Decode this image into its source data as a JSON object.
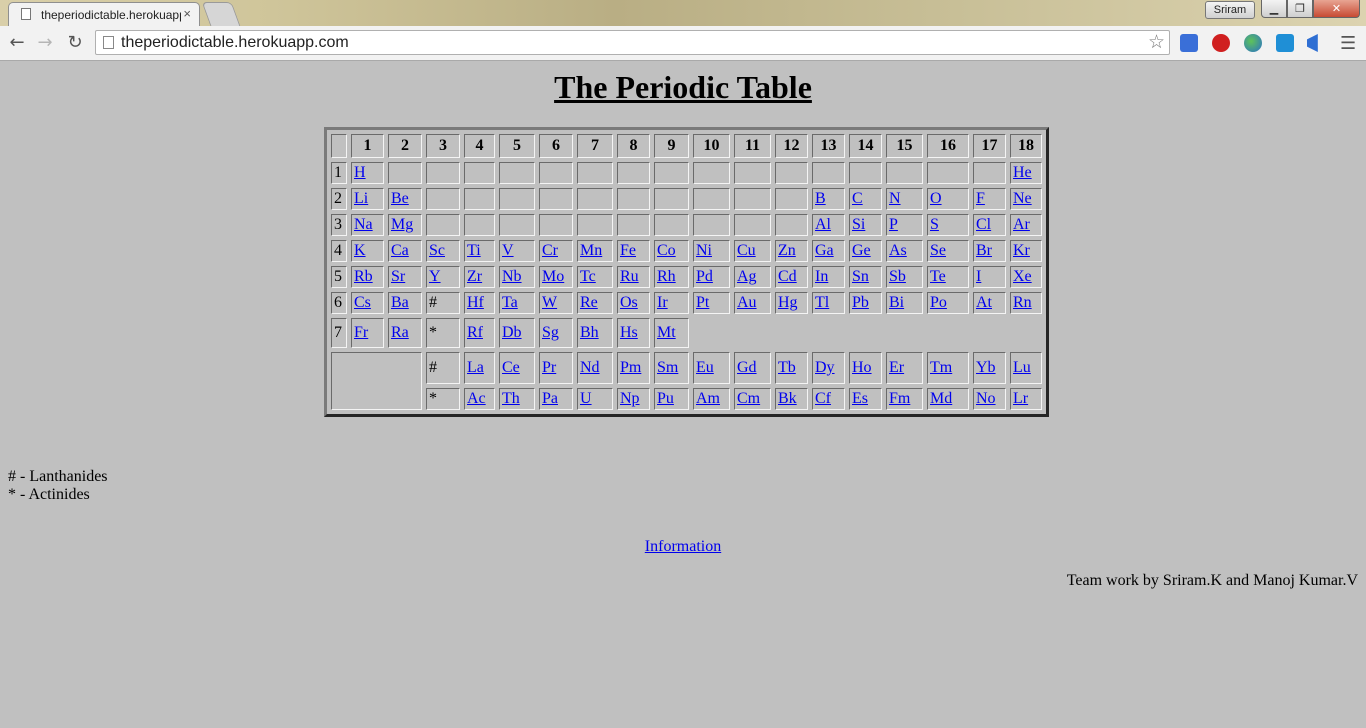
{
  "browser": {
    "tab_title": "theperiodictable.herokuapp.com",
    "tab_close": "×",
    "user": "Sriram",
    "url": "theperiodictable.herokuapp.com",
    "window_min": "▁",
    "window_max": "❐",
    "window_close": "✕"
  },
  "page": {
    "title": "The Periodic Table",
    "groups": [
      "1",
      "2",
      "3",
      "4",
      "5",
      "6",
      "7",
      "8",
      "9",
      "10",
      "11",
      "12",
      "13",
      "14",
      "15",
      "16",
      "17",
      "18"
    ],
    "periods": [
      {
        "num": "1",
        "cells": [
          "H",
          "",
          "",
          "",
          "",
          "",
          "",
          "",
          "",
          "",
          "",
          "",
          "",
          "",
          "",
          "",
          "",
          "He"
        ]
      },
      {
        "num": "2",
        "cells": [
          "Li",
          "Be",
          "",
          "",
          "",
          "",
          "",
          "",
          "",
          "",
          "",
          "",
          "B",
          "C",
          "N",
          "O",
          "F",
          "Ne"
        ]
      },
      {
        "num": "3",
        "cells": [
          "Na",
          "Mg",
          "",
          "",
          "",
          "",
          "",
          "",
          "",
          "",
          "",
          "",
          "Al",
          "Si",
          "P",
          "S",
          "Cl",
          "Ar"
        ]
      },
      {
        "num": "4",
        "cells": [
          "K",
          "Ca",
          "Sc",
          "Ti",
          "V",
          "Cr",
          "Mn",
          "Fe",
          "Co",
          "Ni",
          "Cu",
          "Zn",
          "Ga",
          "Ge",
          "As",
          "Se",
          "Br",
          "Kr"
        ]
      },
      {
        "num": "5",
        "cells": [
          "Rb",
          "Sr",
          "Y",
          "Zr",
          "Nb",
          "Mo",
          "Tc",
          "Ru",
          "Rh",
          "Pd",
          "Ag",
          "Cd",
          "In",
          "Sn",
          "Sb",
          "Te",
          "I",
          "Xe"
        ]
      },
      {
        "num": "6",
        "cells": [
          "Cs",
          "Ba",
          "#",
          "Hf",
          "Ta",
          "W",
          "Re",
          "Os",
          "Ir",
          "Pt",
          "Au",
          "Hg",
          "Tl",
          "Pb",
          "Bi",
          "Po",
          "At",
          "Rn"
        ]
      },
      {
        "num": "7",
        "cells": [
          "Fr",
          "Ra",
          "*",
          "Rf",
          "Db",
          "Sg",
          "Bh",
          "Hs",
          "Mt"
        ]
      }
    ],
    "lanthanides": {
      "marker": "#",
      "elements": [
        "La",
        "Ce",
        "Pr",
        "Nd",
        "Pm",
        "Sm",
        "Eu",
        "Gd",
        "Tb",
        "Dy",
        "Ho",
        "Er",
        "Tm",
        "Yb",
        "Lu"
      ]
    },
    "actinides": {
      "marker": "*",
      "elements": [
        "Ac",
        "Th",
        "Pa",
        "U",
        "Np",
        "Pu",
        "Am",
        "Cm",
        "Bk",
        "Cf",
        "Es",
        "Fm",
        "Md",
        "No",
        "Lr"
      ]
    },
    "legend": [
      "# - Lanthanides",
      "* - Actinides"
    ],
    "info_link": "Information",
    "credit": "Team work by Sriram.K and Manoj Kumar.V"
  }
}
